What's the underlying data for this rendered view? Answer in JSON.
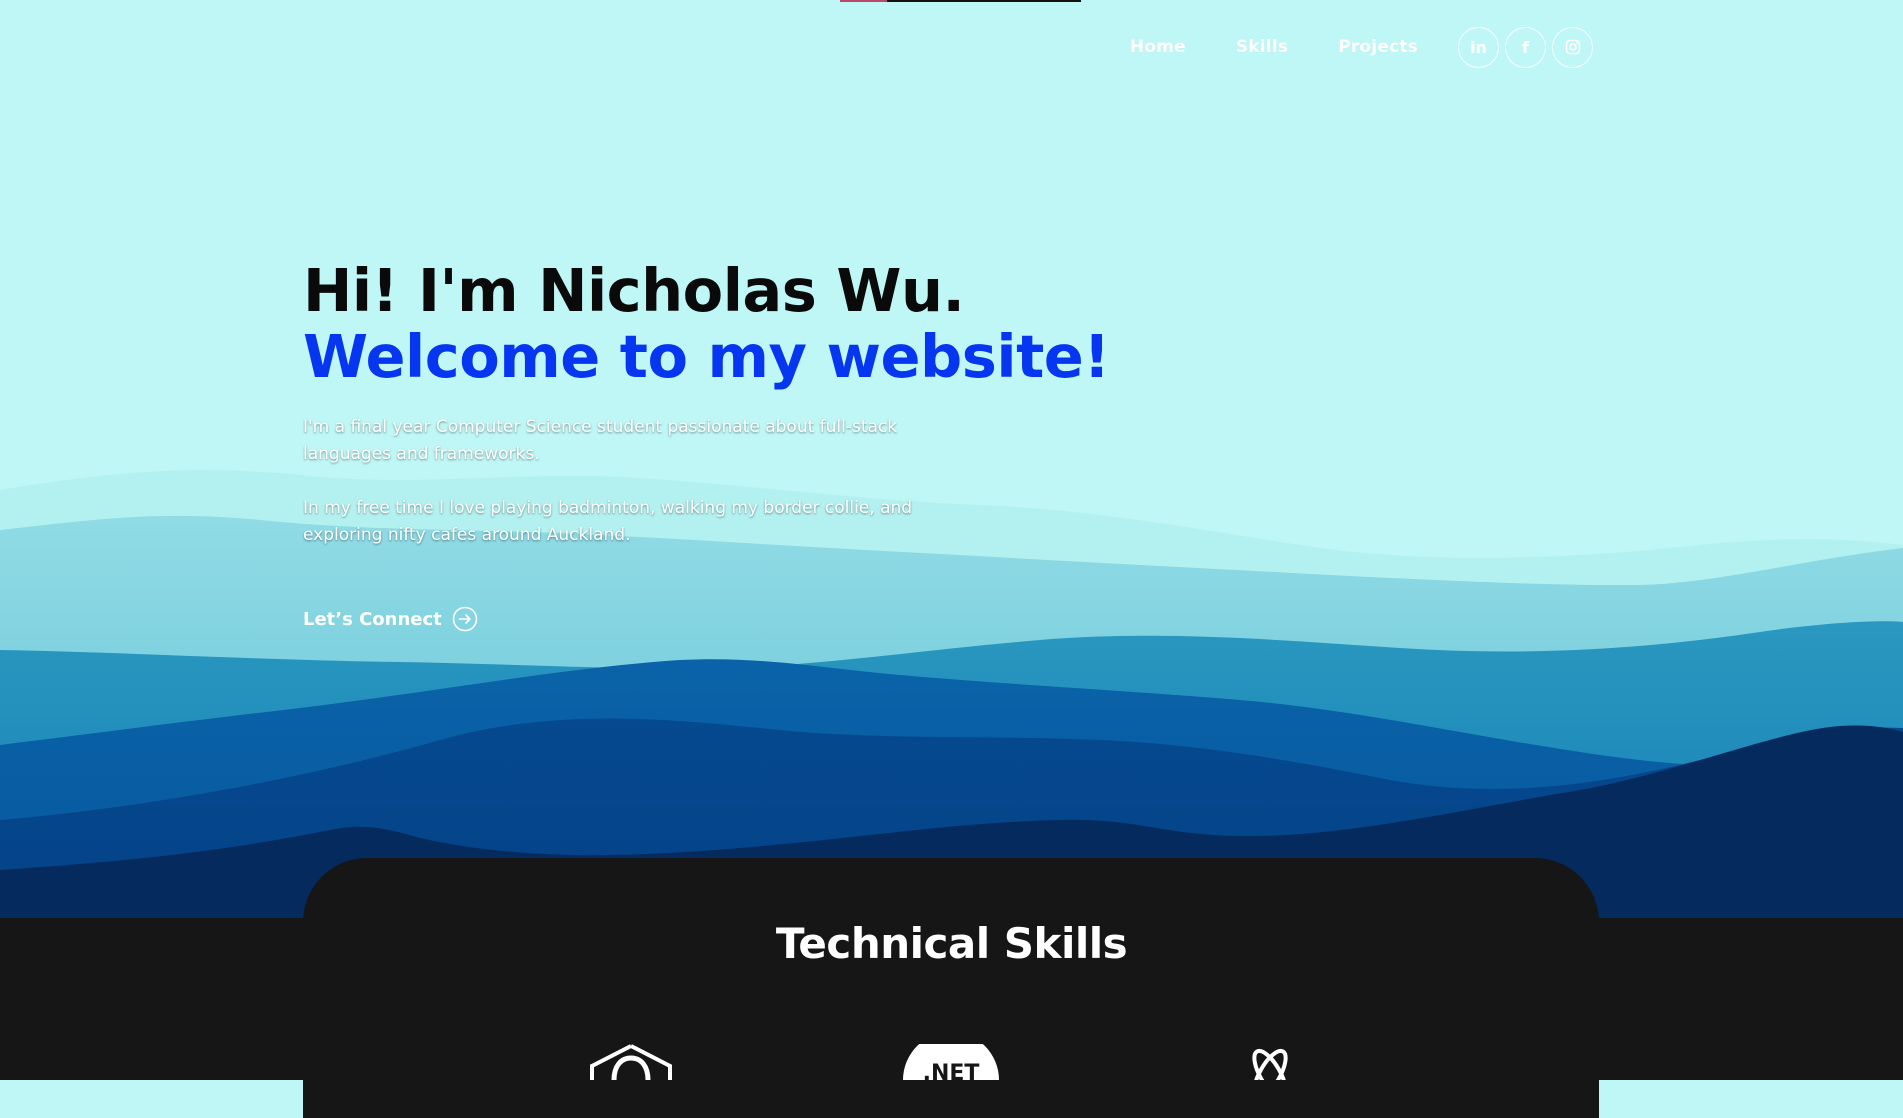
{
  "nav": {
    "links": [
      "Home",
      "Skills",
      "Projects"
    ],
    "social": [
      {
        "icon": "linkedin-icon",
        "glyph": "in"
      },
      {
        "icon": "facebook-icon",
        "glyph": "f"
      },
      {
        "icon": "instagram-icon",
        "glyph": ""
      }
    ]
  },
  "hero": {
    "greeting": "Hi! I'm Nicholas Wu.",
    "welcome": "Welcome to my website!",
    "paragraph1": "I'm a final year Computer Science student passionate about full-stack languages and frameworks.",
    "paragraph2": "In my free time I love playing badminton, walking my border collie, and exploring nifty cafes around Auckland.",
    "cta": "Let’s Connect"
  },
  "skills": {
    "title": "Technical Skills",
    "icons": [
      "csharp-icon",
      "dotnet-icon",
      "react-icon"
    ]
  },
  "colors": {
    "sky": "#bff7f6",
    "accent_blue": "#0736f0",
    "dark": "#161616"
  }
}
